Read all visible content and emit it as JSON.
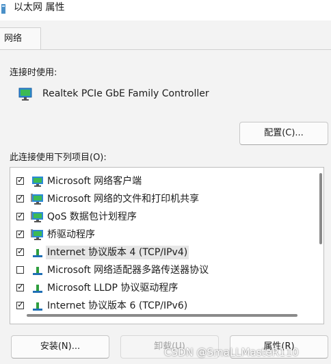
{
  "window": {
    "title": "以太网 属性"
  },
  "tabs": [
    {
      "label": "网络"
    }
  ],
  "connect_using": {
    "label": "连接时使用:",
    "adapter": "Realtek PCIe GbE Family Controller"
  },
  "configure_button": "配置(C)...",
  "items_label": "此连接使用下列项目(O):",
  "items": [
    {
      "label": "Microsoft 网络客户端",
      "checked": true,
      "icon": "network-client-icon"
    },
    {
      "label": "Microsoft 网络的文件和打印机共享",
      "checked": true,
      "icon": "network-service-icon"
    },
    {
      "label": "QoS 数据包计划程序",
      "checked": true,
      "icon": "network-service-icon"
    },
    {
      "label": "桥驱动程序",
      "checked": true,
      "icon": "network-service-icon"
    },
    {
      "label": "Internet 协议版本 4 (TCP/IPv4)",
      "checked": true,
      "selected": true,
      "icon": "protocol-icon"
    },
    {
      "label": "Microsoft 网络适配器多路传送器协议",
      "checked": false,
      "icon": "protocol-icon"
    },
    {
      "label": "Microsoft LLDP 协议驱动程序",
      "checked": true,
      "icon": "protocol-icon"
    },
    {
      "label": "Internet 协议版本 6 (TCP/IPv6)",
      "checked": true,
      "icon": "protocol-icon"
    }
  ],
  "buttons": {
    "install": "安装(N)...",
    "uninstall": "卸载(U)",
    "properties": "属性(R)"
  },
  "watermark": "CSDN @SmaLLMasteR110",
  "colors": {
    "monitor": "#2b88d8",
    "screen_green": "#3cba54",
    "protocol_green": "#2e9e3e",
    "protocol_base": "#1f6fb5"
  }
}
